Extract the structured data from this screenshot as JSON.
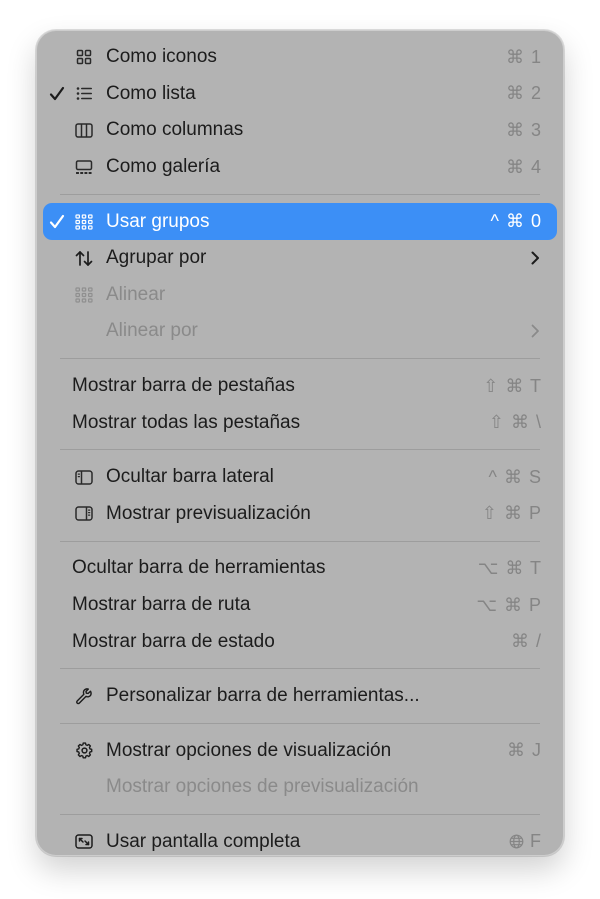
{
  "menu": {
    "items": [
      {
        "label": "Como iconos",
        "shortcut": "⌘ 1",
        "icon": "grid-icon"
      },
      {
        "label": "Como lista",
        "shortcut": "⌘ 2",
        "icon": "list-icon",
        "checked": true
      },
      {
        "label": "Como columnas",
        "shortcut": "⌘ 3",
        "icon": "columns-icon"
      },
      {
        "label": "Como galería",
        "shortcut": "⌘ 4",
        "icon": "gallery-icon"
      },
      {
        "label": "Usar grupos",
        "shortcut": "^ ⌘ 0",
        "icon": "groups-icon",
        "checked": true,
        "highlighted": true
      },
      {
        "label": "Agrupar por",
        "icon": "sort-arrows-icon",
        "submenu": true
      },
      {
        "label": "Alinear",
        "icon": "align-grid-icon",
        "disabled": true
      },
      {
        "label": "Alinear por",
        "submenu": true,
        "disabled": true
      },
      {
        "label": "Mostrar barra de pestañas",
        "shortcut": "⇧ ⌘ T"
      },
      {
        "label": "Mostrar todas las pestañas",
        "shortcut": "⇧ ⌘ \\"
      },
      {
        "label": "Ocultar barra lateral",
        "shortcut": "^ ⌘ S",
        "icon": "sidebar-icon"
      },
      {
        "label": "Mostrar previsualización",
        "shortcut": "⇧ ⌘ P",
        "icon": "preview-panel-icon"
      },
      {
        "label": "Ocultar barra de herramientas",
        "shortcut": "⌥ ⌘ T"
      },
      {
        "label": "Mostrar barra de ruta",
        "shortcut": "⌥ ⌘ P"
      },
      {
        "label": "Mostrar barra de estado",
        "shortcut": "⌘ /"
      },
      {
        "label": "Personalizar barra de herramientas...",
        "icon": "wrench-icon"
      },
      {
        "label": "Mostrar opciones de visualización",
        "shortcut": "⌘ J",
        "icon": "gear-icon"
      },
      {
        "label": "Mostrar opciones de previsualización",
        "disabled": true
      },
      {
        "label": "Usar pantalla completa",
        "shortcut": "F",
        "shortcut_icon": "globe-icon",
        "icon": "fullscreen-icon"
      }
    ]
  },
  "colors": {
    "menu_background": "#b3b3b3",
    "highlight": "#3c8ff6",
    "text": "#1c1c1c",
    "disabled_text": "#8a8a8a",
    "shortcut_text": "#858585"
  }
}
